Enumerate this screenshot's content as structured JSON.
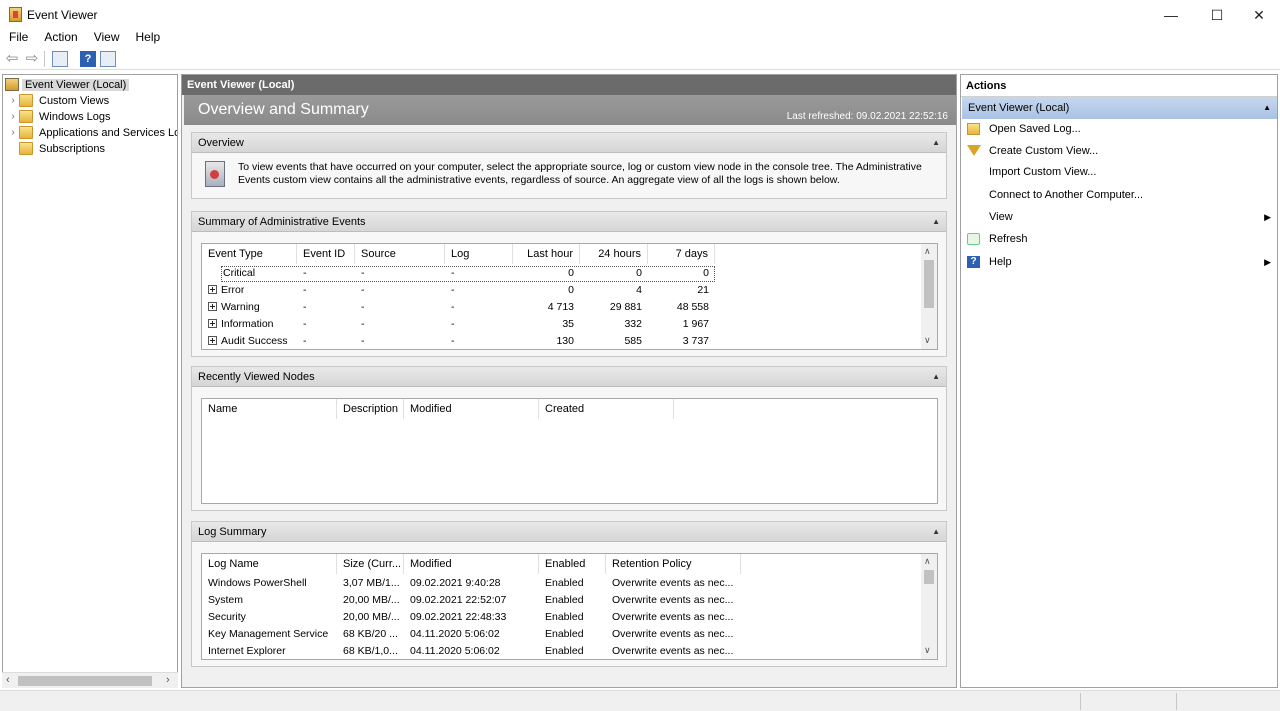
{
  "window": {
    "title": "Event Viewer",
    "controls": {
      "minimize": "—",
      "maximize": "☐",
      "close": "✕"
    }
  },
  "menu": [
    "File",
    "Action",
    "View",
    "Help"
  ],
  "toolbar": {
    "icons": [
      "back-arrow-icon",
      "forward-arrow-icon",
      "show-hide-tree-icon",
      "help-icon",
      "show-hide-action-pane-icon"
    ],
    "back": "⇦",
    "forward": "⇨",
    "help": "?"
  },
  "tree": {
    "items": [
      {
        "label": "Event Viewer (Local)",
        "icon": "event-viewer-icon",
        "selected": true
      },
      {
        "label": "Custom Views",
        "icon": "folder-icon"
      },
      {
        "label": "Windows Logs",
        "icon": "folder-icon"
      },
      {
        "label": "Applications and Services Lo",
        "icon": "folder-icon"
      },
      {
        "label": "Subscriptions",
        "icon": "folder-icon"
      }
    ],
    "expander": "›"
  },
  "center": {
    "header": "Event Viewer (Local)",
    "banner_title": "Overview and Summary",
    "last_refreshed": "Last refreshed: 09.02.2021 22:52:16",
    "overview": {
      "title": "Overview",
      "text": "To view events that have occurred on your computer, select the appropriate source, log or custom view node in the console tree. The Administrative Events custom view contains all the administrative events, regardless of source. An aggregate view of all the logs is shown below."
    },
    "summary": {
      "title": "Summary of Administrative Events",
      "columns": [
        "Event Type",
        "Event ID",
        "Source",
        "Log",
        "Last hour",
        "24 hours",
        "7 days"
      ],
      "rows": [
        {
          "type": "Critical",
          "id": "-",
          "source": "-",
          "log": "-",
          "hour": "0",
          "day": "0",
          "week": "0",
          "expandable": false
        },
        {
          "type": "Error",
          "id": "-",
          "source": "-",
          "log": "-",
          "hour": "0",
          "day": "4",
          "week": "21",
          "expandable": true
        },
        {
          "type": "Warning",
          "id": "-",
          "source": "-",
          "log": "-",
          "hour": "4 713",
          "day": "29 881",
          "week": "48 558",
          "expandable": true
        },
        {
          "type": "Information",
          "id": "-",
          "source": "-",
          "log": "-",
          "hour": "35",
          "day": "332",
          "week": "1 967",
          "expandable": true
        },
        {
          "type": "Audit Success",
          "id": "-",
          "source": "-",
          "log": "-",
          "hour": "130",
          "day": "585",
          "week": "3 737",
          "expandable": true
        }
      ]
    },
    "recent": {
      "title": "Recently Viewed Nodes",
      "columns": [
        "Name",
        "Description",
        "Modified",
        "Created"
      ]
    },
    "logsummary": {
      "title": "Log Summary",
      "columns": [
        "Log Name",
        "Size (Curr...",
        "Modified",
        "Enabled",
        "Retention Policy"
      ],
      "rows": [
        {
          "name": "Windows PowerShell",
          "size": "3,07 MB/1...",
          "modified": "09.02.2021 9:40:28",
          "enabled": "Enabled",
          "policy": "Overwrite events as nec..."
        },
        {
          "name": "System",
          "size": "20,00 MB/...",
          "modified": "09.02.2021 22:52:07",
          "enabled": "Enabled",
          "policy": "Overwrite events as nec..."
        },
        {
          "name": "Security",
          "size": "20,00 MB/...",
          "modified": "09.02.2021 22:48:33",
          "enabled": "Enabled",
          "policy": "Overwrite events as nec..."
        },
        {
          "name": "Key Management Service",
          "size": "68 KB/20 ...",
          "modified": "04.11.2020 5:06:02",
          "enabled": "Enabled",
          "policy": "Overwrite events as nec..."
        },
        {
          "name": "Internet Explorer",
          "size": "68 KB/1,0...",
          "modified": "04.11.2020 5:06:02",
          "enabled": "Enabled",
          "policy": "Overwrite events as nec..."
        }
      ]
    },
    "collapse_glyph": "▲",
    "scroll_up": "∧",
    "scroll_down": "∨"
  },
  "actions": {
    "title": "Actions",
    "group": "Event Viewer (Local)",
    "items": [
      {
        "label": "Open Saved Log...",
        "icon": "open-folder-icon"
      },
      {
        "label": "Create Custom View...",
        "icon": "filter-icon"
      },
      {
        "label": "Import Custom View...",
        "icon": ""
      },
      {
        "label": "Connect to Another Computer...",
        "icon": ""
      },
      {
        "label": "View",
        "icon": "",
        "submenu": true
      },
      {
        "label": "Refresh",
        "icon": "refresh-icon"
      },
      {
        "label": "Help",
        "icon": "help-icon",
        "submenu": true
      }
    ],
    "submenu_glyph": "▶"
  },
  "hscroll": {
    "left": "‹",
    "right": "›"
  }
}
